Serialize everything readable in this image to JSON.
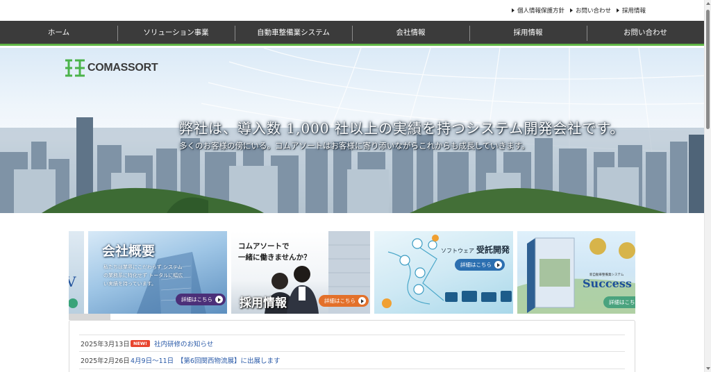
{
  "utility_links": [
    {
      "label": "個人情報保護方針"
    },
    {
      "label": "お問い合わせ"
    },
    {
      "label": "採用情報"
    }
  ],
  "nav": [
    {
      "label": "ホーム"
    },
    {
      "label": "ソリューション事業"
    },
    {
      "label": "自動車整備業システム"
    },
    {
      "label": "会社情報"
    },
    {
      "label": "採用情報"
    },
    {
      "label": "お問い合わせ"
    }
  ],
  "brand": {
    "logo_text": "COMASSORT",
    "accent": "#5fb546",
    "nav_bg": "#3b3b3b"
  },
  "hero": {
    "title": "弊社は、導入数 1,000 社以上の実績を持つシステム開発会社です。",
    "subtitle": "多くのお客様の傍にいる。コムアソートはお客様に寄り添いながらこれからも成長していきます。"
  },
  "banners": {
    "company": {
      "title": "会社概要",
      "text": "私たちは業界にこだわらず システムの業務系に特化せず トータルに幅広い実績を持っています。",
      "button": "詳細はこちら"
    },
    "recruit": {
      "text_line1": "コムアソートで",
      "text_line2": "一緒に働きませんか？",
      "title": "採用情報",
      "button": "詳細はこちら"
    },
    "software": {
      "prefix": "ソフトウェア",
      "title": "受託開発",
      "button": "詳細はこちら"
    },
    "product": {
      "caption": "新自動車整備業システム",
      "title": "Success",
      "button": "詳細はこちら"
    }
  },
  "news": [
    {
      "date": "2025年3月13日",
      "badge": "NEW!",
      "title": "社内研修のお知らせ"
    },
    {
      "date": "2025年2月26日",
      "badge": "",
      "title": "4月9日～11日　【第6回関西物流展】に出展します"
    }
  ]
}
